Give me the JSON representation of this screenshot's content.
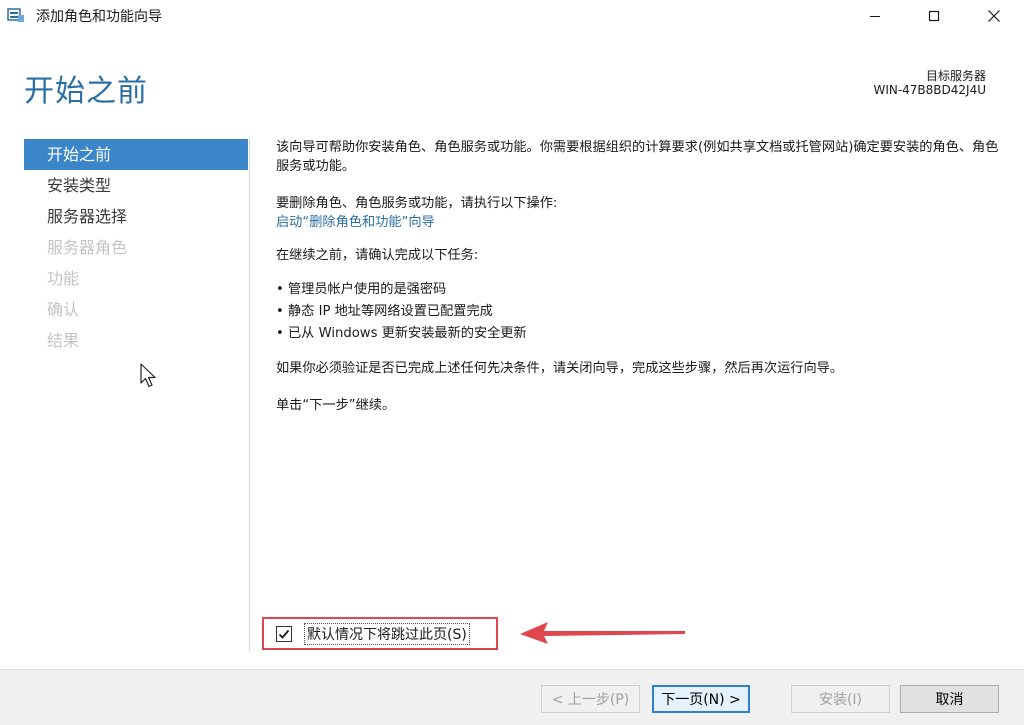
{
  "window": {
    "title": "添加角色和功能向导"
  },
  "header": {
    "page_title": "开始之前",
    "target_label": "目标服务器",
    "target_name": "WIN-47B8BD42J4U"
  },
  "nav": {
    "items": [
      {
        "label": "开始之前",
        "state": "active"
      },
      {
        "label": "安装类型",
        "state": "enabled"
      },
      {
        "label": "服务器选择",
        "state": "enabled"
      },
      {
        "label": "服务器角色",
        "state": "disabled"
      },
      {
        "label": "功能",
        "state": "disabled"
      },
      {
        "label": "确认",
        "state": "disabled"
      },
      {
        "label": "结果",
        "state": "disabled"
      }
    ]
  },
  "content": {
    "intro": "该向导可帮助你安装角色、角色服务或功能。你需要根据组织的计算要求(例如共享文档或托管网站)确定要安装的角色、角色服务或功能。",
    "remove_text": "要删除角色、角色服务或功能，请执行以下操作:",
    "remove_link": "启动“删除角色和功能”向导",
    "before_text": "在继续之前，请确认完成以下任务:",
    "bullets": [
      "管理员帐户使用的是强密码",
      "静态 IP 地址等网络设置已配置完成",
      "已从 Windows 更新安装最新的安全更新"
    ],
    "bullet_symbol": "•",
    "verify_text": "如果你必须验证是否已完成上述任何先决条件，请关闭向导，完成这些步骤，然后再次运行向导。",
    "continue_text": "单击“下一步”继续。"
  },
  "skip": {
    "label": "默认情况下将跳过此页(S)",
    "checked": true
  },
  "buttons": {
    "prev": "< 上一步(P)",
    "next": "下一页(N) >",
    "install": "安装(I)",
    "cancel": "取消"
  },
  "colors": {
    "accent": "#3b86c9",
    "title": "#2b6ea5",
    "highlight": "#e0474c"
  }
}
